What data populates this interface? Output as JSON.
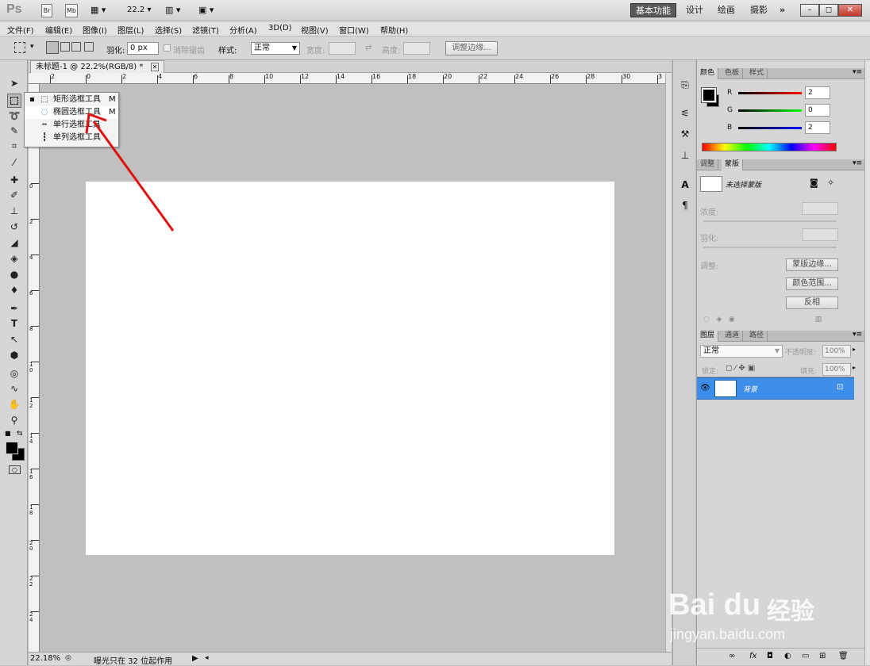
{
  "app": {
    "logo": "Ps",
    "top_buttons": [
      "Br",
      "Mb"
    ],
    "zoom_value": "22.2",
    "workspaces": [
      "基本功能",
      "设计",
      "绘画",
      "摄影",
      "»"
    ],
    "active_workspace": "基本功能",
    "window_buttons": [
      "–",
      "◻",
      "✕"
    ]
  },
  "menu": [
    "文件(F)",
    "编辑(E)",
    "图像(I)",
    "图层(L)",
    "选择(S)",
    "滤镜(T)",
    "分析(A)",
    "3D(D)",
    "视图(V)",
    "窗口(W)",
    "帮助(H)"
  ],
  "options": {
    "feather_label": "羽化:",
    "feather_value": "0 px",
    "antialias_label": "消除锯齿",
    "style_label": "样式:",
    "style_value": "正常",
    "width_label": "宽度:",
    "height_label": "高度:",
    "refine_button": "调整边缘..."
  },
  "document": {
    "tab_title": "未标题-1 @ 22.2%(RGB/8) *",
    "tab_close": "✕",
    "ruler_h": [
      "2",
      "0",
      "2",
      "4",
      "6",
      "8",
      "10",
      "12",
      "14",
      "16",
      "18",
      "20",
      "22",
      "24",
      "26",
      "28",
      "30",
      "3"
    ],
    "ruler_v": [
      "0",
      "2",
      "4",
      "6",
      "8",
      "1 0",
      "1 2",
      "1 4",
      "1 6",
      "1 8",
      "2 0",
      "2 2",
      "2 4"
    ]
  },
  "flyout": {
    "items": [
      {
        "icon": "⬚",
        "label": "矩形选框工具",
        "shortcut": "M",
        "active": true
      },
      {
        "icon": "◌",
        "label": "椭圆选框工具",
        "shortcut": "M",
        "active": false
      },
      {
        "icon": "┅",
        "label": "单行选框工具",
        "shortcut": "",
        "active": false
      },
      {
        "icon": "┇",
        "label": "单列选框工具",
        "shortcut": "",
        "active": false
      }
    ]
  },
  "status": {
    "zoom": "22.18%",
    "info": "曝光只在 32 位起作用"
  },
  "color_panel": {
    "tabs": [
      "颜色",
      "色板",
      "样式"
    ],
    "channels": [
      {
        "label": "R",
        "value": "2",
        "color": "#d02020"
      },
      {
        "label": "G",
        "value": "0",
        "color": "#20a020"
      },
      {
        "label": "B",
        "value": "2",
        "color": "#2020c0"
      }
    ]
  },
  "masks_panel": {
    "tabs": [
      "调整",
      "蒙版"
    ],
    "title": "未选择蒙版",
    "density_label": "浓度:",
    "feather_label": "羽化:",
    "refine_label": "调整:",
    "buttons": [
      "蒙版边缘...",
      "颜色范围...",
      "反相"
    ]
  },
  "layers_panel": {
    "tabs": [
      "图层",
      "通道",
      "路径"
    ],
    "blend_mode": "正常",
    "opacity_label": "不透明度:",
    "opacity_value": "100%",
    "lock_label": "锁定:",
    "fill_label": "填充:",
    "fill_value": "100%",
    "layer_name": "背景",
    "bottom_icons": [
      "∞",
      "fx",
      "◘",
      "◐",
      "▭",
      "⊞",
      "🗑"
    ]
  },
  "watermark": {
    "logo": "Bai du",
    "brand": "经验",
    "url": "jingyan.baidu.com"
  },
  "colors": {
    "accent": "#3d8ee8",
    "arrow": "#e01010",
    "foreground": "#000000",
    "background": "#ffffff"
  }
}
